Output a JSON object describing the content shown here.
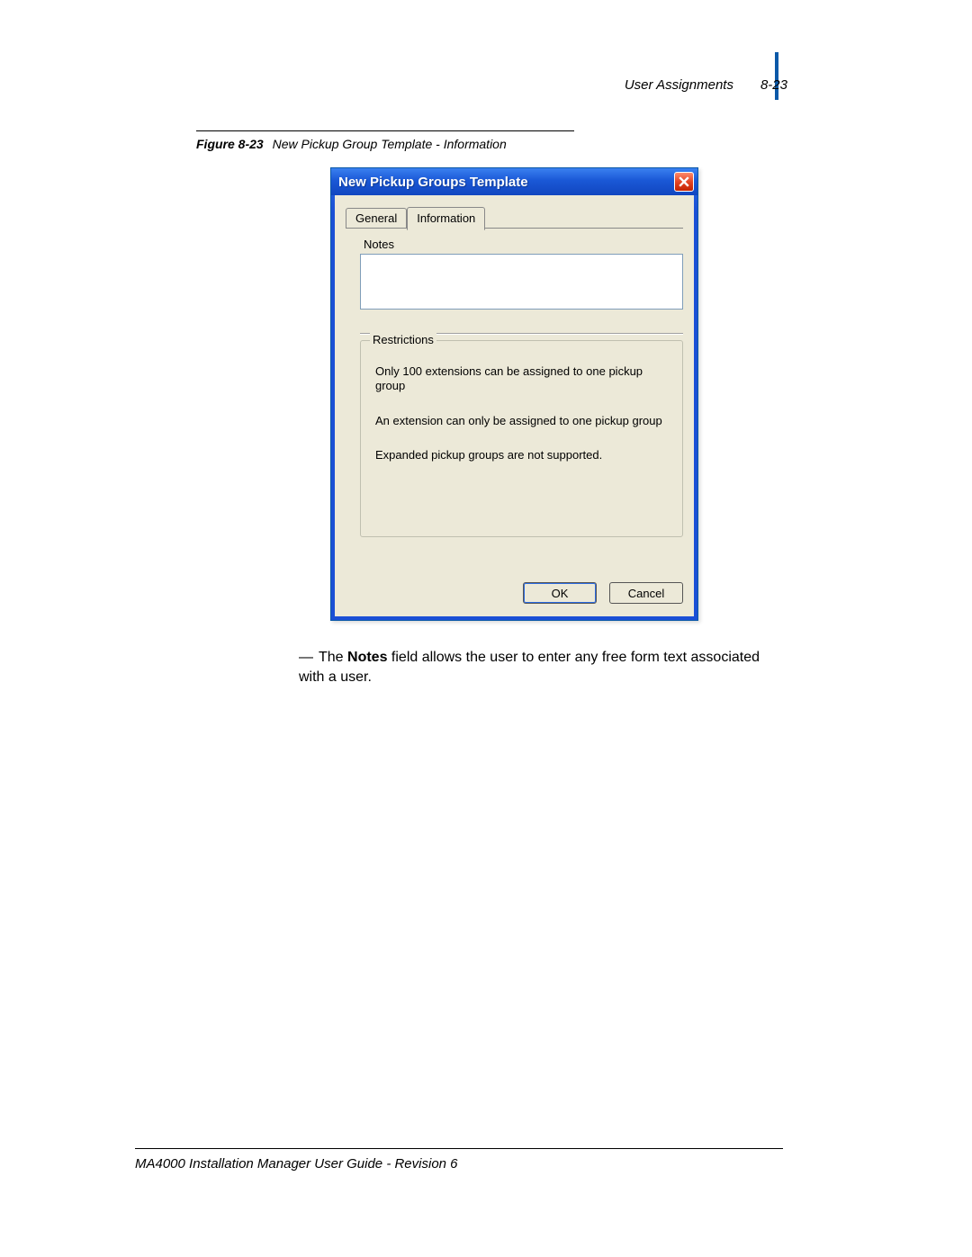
{
  "header": {
    "section": "User Assignments",
    "pageref": "8-23"
  },
  "figure": {
    "num": "Figure 8-23",
    "title": "New Pickup Group Template - Information"
  },
  "dialog": {
    "title": "New Pickup Groups Template",
    "tabs": {
      "general": "General",
      "information": "Information"
    },
    "notes_label": "Notes",
    "restrictions_legend": "Restrictions",
    "restrictions": {
      "r1": "Only 100 extensions can be assigned to one pickup group",
      "r2": "An extension can only be assigned to one pickup group",
      "r3": "Expanded pickup groups are not supported."
    },
    "buttons": {
      "ok": "OK",
      "cancel": "Cancel"
    }
  },
  "body": {
    "dash": "—",
    "pre": "The ",
    "bold": "Notes",
    "post": " field allows the user to enter any free form text associated with a user."
  },
  "footer": {
    "text": "MA4000 Installation Manager User Guide - Revision 6"
  }
}
